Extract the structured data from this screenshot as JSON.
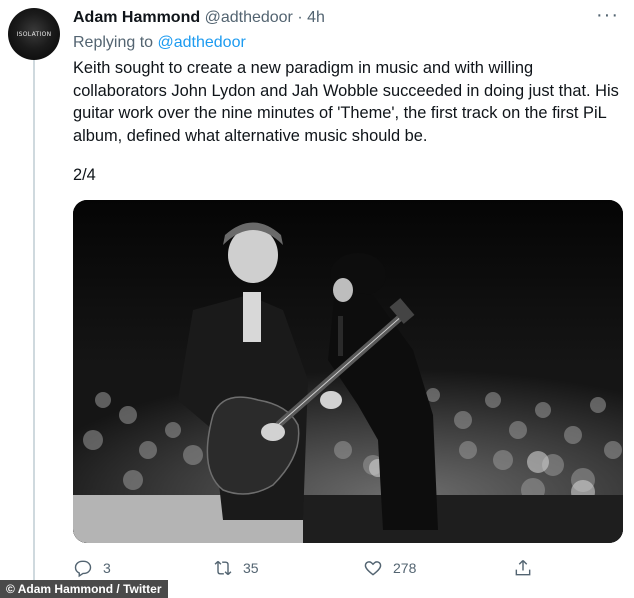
{
  "tweet": {
    "avatar_text": "ISOLATION",
    "display_name": "Adam Hammond",
    "handle": "@adthedoor",
    "separator": "·",
    "time": "4h",
    "more_label": "···",
    "replying_prefix": "Replying to",
    "replying_handle": "@adthedoor",
    "text": "Keith sought to create a new paradigm in music and with willing collaborators John Lydon and Jah Wobble succeeded in doing just that. His guitar work over the nine minutes of 'Theme', the first track on the first PiL album, defined what alternative music should be.",
    "thread_counter": "2/4"
  },
  "actions": {
    "replies": "3",
    "retweets": "35",
    "likes": "278"
  },
  "credit": "© Adam Hammond / Twitter",
  "icons": {
    "reply": "reply-icon",
    "retweet": "retweet-icon",
    "like": "heart-icon",
    "share": "share-icon",
    "more": "more-icon"
  },
  "colors": {
    "link": "#1d9bf0",
    "secondary_text": "#536471",
    "thread_line": "#cfd9de"
  }
}
